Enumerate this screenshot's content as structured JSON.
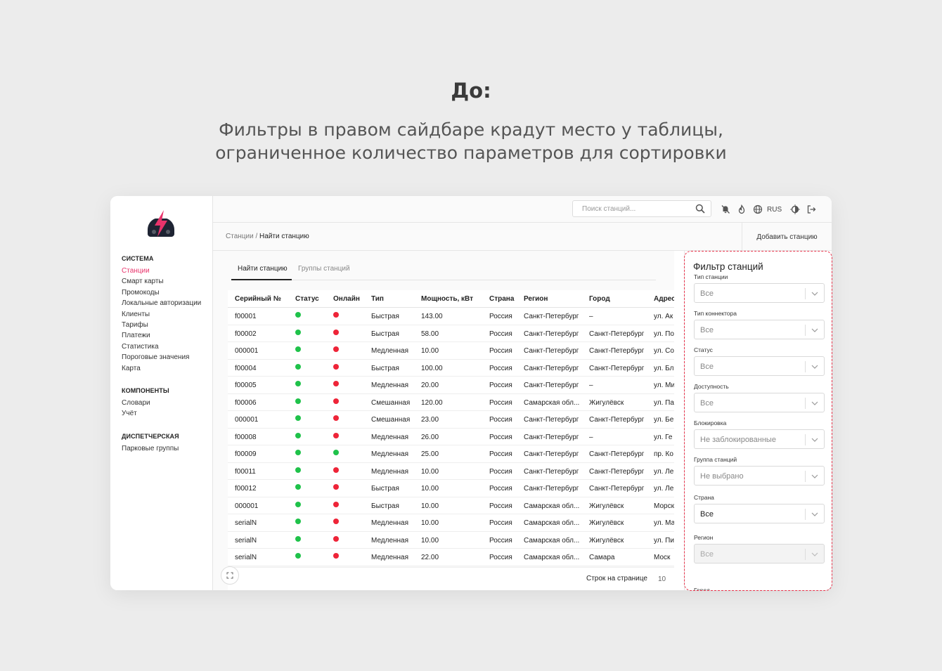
{
  "slide": {
    "heading": "До:",
    "subheading_line1": "Фильтры в правом сайдбаре крадут место у таблицы,",
    "subheading_line2": "ограниченное количество параметров для сортировки"
  },
  "colors": {
    "accent": "#e8336b",
    "online_green": "#1fc24a",
    "offline_red": "#ee2438",
    "filter_highlight": "#e8344c"
  },
  "sidebar": {
    "sections": [
      {
        "title": "СИСТЕМА",
        "items": [
          "Станции",
          "Смарт карты",
          "Промокоды",
          "Локальные авторизации",
          "Клиенты",
          "Тарифы",
          "Платежи",
          "Статистика",
          "Пороговые значения",
          "Карта"
        ]
      },
      {
        "title": "КОМПОНЕНТЫ",
        "items": [
          "Словари",
          "Учёт"
        ]
      },
      {
        "title": "ДИСПЕТЧЕРСКАЯ",
        "items": [
          "Парковые группы"
        ]
      }
    ]
  },
  "topbar": {
    "search_placeholder": "Поиск станций...",
    "language": "RUS"
  },
  "breadcrumb": {
    "parent": "Станции",
    "separator": "/",
    "current": "Найти станцию"
  },
  "add_station_label": "Добавить станцию",
  "tabs": [
    "Найти станцию",
    "Группы станций"
  ],
  "table": {
    "columns": [
      "Серийный №",
      "Статус",
      "Онлайн",
      "Тип",
      "Мощность, кВт",
      "Страна",
      "Регион",
      "Город",
      "Адрес"
    ],
    "rows": [
      {
        "serial": "f00001",
        "status": "green",
        "online": "red",
        "type": "Быстрая",
        "power": "143.00",
        "country": "Россия",
        "region": "Санкт-Петербург",
        "city": "–",
        "address": "ул. Ак"
      },
      {
        "serial": "f00002",
        "status": "green",
        "online": "red",
        "type": "Быстрая",
        "power": "58.00",
        "country": "Россия",
        "region": "Санкт-Петербург",
        "city": "Санкт-Петербург",
        "address": "ул. По"
      },
      {
        "serial": "000001",
        "status": "green",
        "online": "red",
        "type": "Медленная",
        "power": "10.00",
        "country": "Россия",
        "region": "Санкт-Петербург",
        "city": "Санкт-Петербург",
        "address": "ул. Со"
      },
      {
        "serial": "f00004",
        "status": "green",
        "online": "red",
        "type": "Быстрая",
        "power": "100.00",
        "country": "Россия",
        "region": "Санкт-Петербург",
        "city": "Санкт-Петербург",
        "address": "ул. Бл"
      },
      {
        "serial": "f00005",
        "status": "green",
        "online": "red",
        "type": "Медленная",
        "power": "20.00",
        "country": "Россия",
        "region": "Санкт-Петербург",
        "city": "–",
        "address": "ул. Ми"
      },
      {
        "serial": "f00006",
        "status": "green",
        "online": "red",
        "type": "Смешанная",
        "power": "120.00",
        "country": "Россия",
        "region": "Самарская обл...",
        "city": "Жигулёвск",
        "address": "ул. Па"
      },
      {
        "serial": "000001",
        "status": "green",
        "online": "red",
        "type": "Смешанная",
        "power": "23.00",
        "country": "Россия",
        "region": "Санкт-Петербург",
        "city": "Санкт-Петербург",
        "address": "ул. Бе"
      },
      {
        "serial": "f00008",
        "status": "green",
        "online": "red",
        "type": "Медленная",
        "power": "26.00",
        "country": "Россия",
        "region": "Санкт-Петербург",
        "city": "–",
        "address": "ул. Ге"
      },
      {
        "serial": "f00009",
        "status": "green",
        "online": "green",
        "type": "Медленная",
        "power": "25.00",
        "country": "Россия",
        "region": "Санкт-Петербург",
        "city": "Санкт-Петербург",
        "address": "пр. Ко"
      },
      {
        "serial": "f00011",
        "status": "green",
        "online": "red",
        "type": "Медленная",
        "power": "10.00",
        "country": "Россия",
        "region": "Санкт-Петербург",
        "city": "Санкт-Петербург",
        "address": "ул. Ле"
      },
      {
        "serial": "f00012",
        "status": "green",
        "online": "red",
        "type": "Быстрая",
        "power": "10.00",
        "country": "Россия",
        "region": "Санкт-Петербург",
        "city": "Санкт-Петербург",
        "address": "ул. Ле"
      },
      {
        "serial": "000001",
        "status": "green",
        "online": "red",
        "type": "Быстрая",
        "power": "10.00",
        "country": "Россия",
        "region": "Самарская обл...",
        "city": "Жигулёвск",
        "address": "Морск"
      },
      {
        "serial": "serialN",
        "status": "green",
        "online": "red",
        "type": "Медленная",
        "power": "10.00",
        "country": "Россия",
        "region": "Самарская обл...",
        "city": "Жигулёвск",
        "address": "ул. Ма"
      },
      {
        "serial": "serialN",
        "status": "green",
        "online": "red",
        "type": "Медленная",
        "power": "10.00",
        "country": "Россия",
        "region": "Самарская обл...",
        "city": "Жигулёвск",
        "address": "ул. Пи"
      },
      {
        "serial": "serialN",
        "status": "green",
        "online": "red",
        "type": "Медленная",
        "power": "22.00",
        "country": "Россия",
        "region": "Самарская обл...",
        "city": "Самара",
        "address": "Моск"
      }
    ]
  },
  "pagination": {
    "label": "Строк на странице",
    "value": "10"
  },
  "filter": {
    "title": "Фильтр станций",
    "fields": [
      {
        "label": "Тип станции",
        "value": "Все",
        "disabled": false
      },
      {
        "label": "Тип коннектора",
        "value": "Все",
        "disabled": false
      },
      {
        "label": "Статус",
        "value": "Все",
        "disabled": false
      },
      {
        "label": "Доступность",
        "value": "Все",
        "disabled": false
      },
      {
        "label": "Блокировка",
        "value": "Не заблокированные",
        "disabled": false
      },
      {
        "label": "Группа станций",
        "value": "Не выбрано",
        "disabled": false
      },
      {
        "label": "Страна",
        "value": "Все",
        "disabled": false,
        "filled": true
      },
      {
        "label": "Регион",
        "value": "Все",
        "disabled": true
      }
    ],
    "next_label": "Город"
  }
}
